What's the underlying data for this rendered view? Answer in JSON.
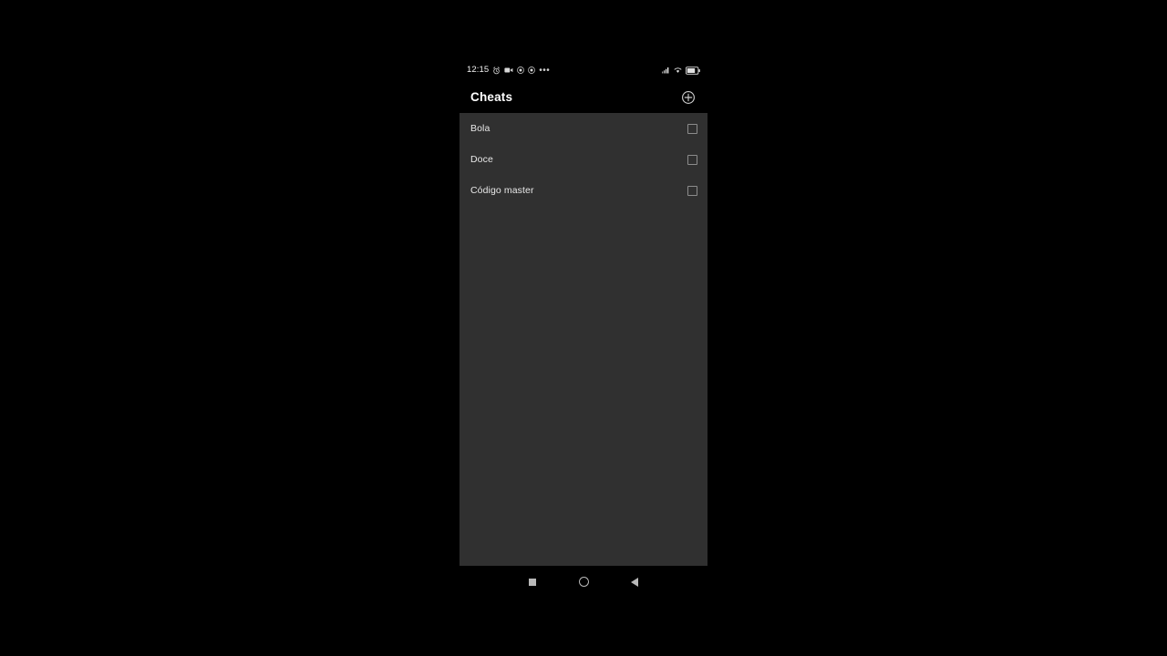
{
  "device": {
    "status_bar": {
      "time": "12:15",
      "left_icons": [
        {
          "name": "alarm-clock-icon"
        },
        {
          "name": "video-camera-icon"
        },
        {
          "name": "screen-record-circle-icon"
        },
        {
          "name": "screen-cast-circle-icon"
        },
        {
          "name": "more-notifications-ellipsis-icon"
        }
      ],
      "right_icons": [
        {
          "name": "cellular-signal-icon"
        },
        {
          "name": "wifi-icon"
        },
        {
          "name": "battery-icon"
        }
      ]
    },
    "app_bar": {
      "title": "Cheats",
      "add_button_label": "add-cheat"
    },
    "cheats": [
      {
        "label": "Bola",
        "checked": false
      },
      {
        "label": "Doce",
        "checked": false
      },
      {
        "label": "Código master",
        "checked": false
      }
    ],
    "nav_bar": {
      "recents_label": "recents",
      "home_label": "home",
      "back_label": "back"
    }
  },
  "colors": {
    "background": "#000000",
    "panel": "#303030",
    "text_primary": "#ffffff",
    "text_secondary": "#e8e8e8",
    "icon": "#b9b9b9"
  }
}
